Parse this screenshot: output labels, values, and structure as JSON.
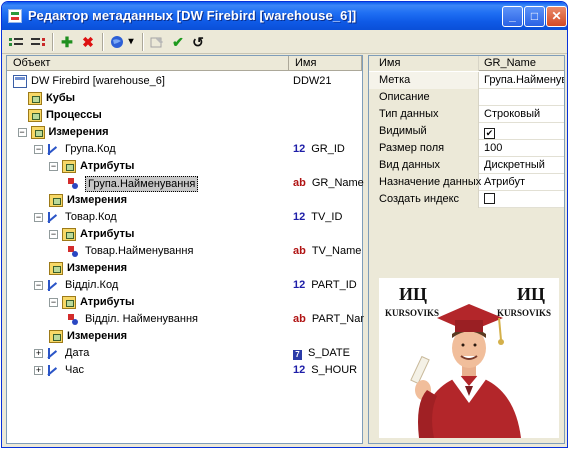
{
  "window": {
    "title": "Редактор метаданных [DW Firebird [warehouse_6]]"
  },
  "titlebar_buttons": {
    "minimize": "_",
    "maximize": "□",
    "close": "✕"
  },
  "toolbar": [
    {
      "name": "add-object-icon"
    },
    {
      "name": "remove-object-icon"
    },
    {
      "name": "add-icon",
      "glyph": "✚"
    },
    {
      "name": "delete-icon",
      "glyph": "✖"
    },
    {
      "name": "dropdown-icon",
      "glyph": "▾"
    },
    {
      "name": "edit-icon"
    },
    {
      "name": "apply-icon",
      "glyph": "✔"
    },
    {
      "name": "undo-icon",
      "glyph": "↺"
    }
  ],
  "tree": {
    "headers": {
      "object": "Объект",
      "name": "Имя"
    },
    "rows": [
      {
        "label": "DW Firebird [warehouse_6]",
        "name": "DDW21",
        "icon": "db"
      },
      {
        "label": "Кубы",
        "bold": true,
        "icon": "folder"
      },
      {
        "label": "Процессы",
        "bold": true,
        "icon": "folder"
      },
      {
        "label": "Измерения",
        "bold": true,
        "icon": "folder",
        "expander": "−"
      },
      {
        "label": "Група.Код",
        "name_type": "12",
        "name": "GR_ID",
        "icon": "dim",
        "expander": "−"
      },
      {
        "label": "Атрибуты",
        "bold": true,
        "icon": "folder",
        "expander": "−"
      },
      {
        "label": "Група.Найменування",
        "name_type": "ab",
        "name": "GR_Name",
        "icon": "attr",
        "selected": true
      },
      {
        "label": "Измерения",
        "bold": true,
        "icon": "folder"
      },
      {
        "label": "Товар.Код",
        "name_type": "12",
        "name": "TV_ID",
        "icon": "dim",
        "expander": "−"
      },
      {
        "label": "Атрибуты",
        "bold": true,
        "icon": "folder",
        "expander": "−"
      },
      {
        "label": "Товар.Найменування",
        "name_type": "ab",
        "name": "TV_Name",
        "icon": "attr"
      },
      {
        "label": "Измерения",
        "bold": true,
        "icon": "folder"
      },
      {
        "label": "Відділ.Код",
        "name_type": "12",
        "name": "PART_ID",
        "icon": "dim",
        "expander": "−"
      },
      {
        "label": "Атрибуты",
        "bold": true,
        "icon": "folder",
        "expander": "−"
      },
      {
        "label": "Відділ. Найменування",
        "name_type": "ab",
        "name": "PART_Nam",
        "icon": "attr"
      },
      {
        "label": "Измерения",
        "bold": true,
        "icon": "folder"
      },
      {
        "label": "Дата",
        "name_type": "7",
        "name": "S_DATE",
        "icon": "dim",
        "expander": "+"
      },
      {
        "label": "Час",
        "name_type": "12",
        "name": "S_HOUR",
        "icon": "dim",
        "expander": "+"
      }
    ]
  },
  "properties": {
    "headers": {
      "name": "Имя",
      "value": "GR_Name"
    },
    "rows": [
      {
        "name": "Метка",
        "value": "Група.Найменува"
      },
      {
        "name": "Описание",
        "value": ""
      },
      {
        "name": "Тип данных",
        "value": "Строковый"
      },
      {
        "name": "Видимый",
        "checkbox": true,
        "checked": true
      },
      {
        "name": "Размер поля",
        "value": "100"
      },
      {
        "name": "Вид данных",
        "value": "Дискретный"
      },
      {
        "name": "Назначение данных",
        "value": "Атрибут"
      },
      {
        "name": "Создать индекс",
        "checkbox": true,
        "checked": false
      }
    ]
  },
  "ad": {
    "left_logo": "ИЦ",
    "left_caption": "KURSOVIKS",
    "right_logo": "ИЦ",
    "right_caption": "KURSOVIKS"
  },
  "colors": {
    "title_bar": "#0a5bee",
    "number_tag": "#1e1ea8",
    "string_tag": "#b01313"
  }
}
